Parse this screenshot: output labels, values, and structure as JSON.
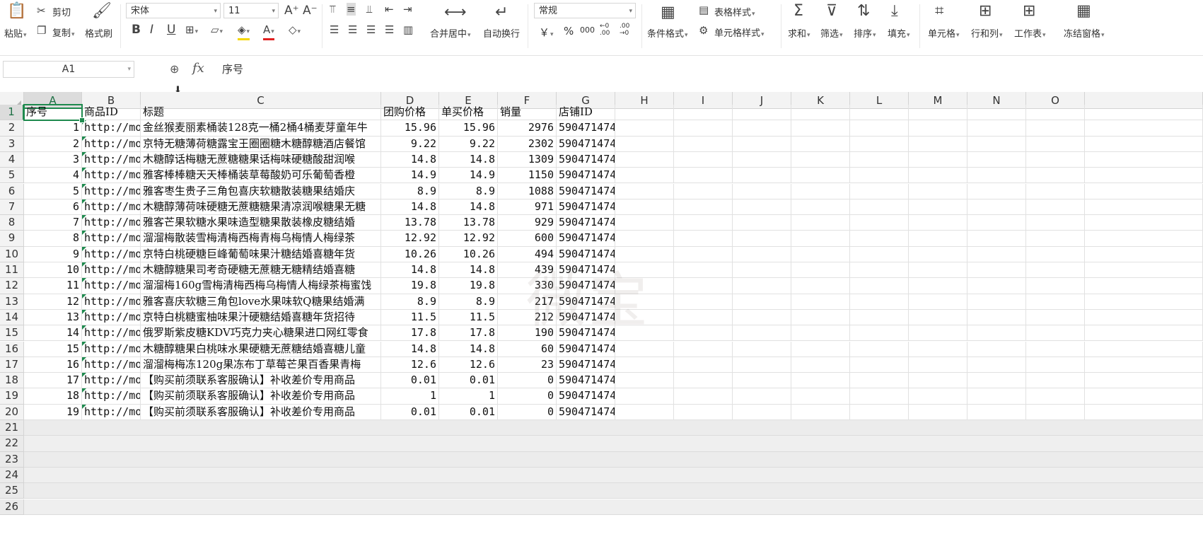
{
  "ribbon": {
    "paste": "粘贴",
    "cut": "剪切",
    "copy": "复制",
    "format_painter": "格式刷",
    "font_name": "宋体",
    "font_size": "11",
    "merge_center": "合并居中",
    "wrap_text": "自动换行",
    "number_format": "常规",
    "currency_symbol": "￥",
    "percent_symbol": "%",
    "thousands_symbol": "000",
    "inc_decimal": "←0 .00",
    "dec_decimal": ".00 →0",
    "conditional_format": "条件格式",
    "table_style": "表格样式",
    "cell_style": "单元格样式",
    "sum": "求和",
    "filter": "筛选",
    "sort": "排序",
    "fill": "填充",
    "cell": "单元格",
    "rows_cols": "行和列",
    "worksheet": "工作表",
    "freeze": "冻结窗格"
  },
  "formula_bar": {
    "name_box": "A1",
    "fx": "fx",
    "content": "序号"
  },
  "columns": [
    "A",
    "B",
    "C",
    "D",
    "E",
    "F",
    "G",
    "H",
    "I",
    "J",
    "K",
    "L",
    "M",
    "N",
    "O"
  ],
  "headers": {
    "A": "序号",
    "B": "商品ID",
    "C": "标题",
    "D": "团购价格",
    "E": "单买价格",
    "F": "销量",
    "G": "店铺ID"
  },
  "rows": [
    {
      "n": "1",
      "id": "http://mob",
      "title": "金丝猴麦丽素桶装128克一桶2桶4桶麦芽童年牛",
      "group": "15.96",
      "single": "15.96",
      "sales": "2976",
      "shop": "590471474"
    },
    {
      "n": "2",
      "id": "http://mob",
      "title": "京特无糖薄荷糖露宝王圈圈糖木糖醇糖酒店餐馆",
      "group": "9.22",
      "single": "9.22",
      "sales": "2302",
      "shop": "590471474"
    },
    {
      "n": "3",
      "id": "http://mob",
      "title": "木糖醇话梅糖无蔗糖糖果话梅味硬糖酸甜润喉",
      "group": "14.8",
      "single": "14.8",
      "sales": "1309",
      "shop": "590471474"
    },
    {
      "n": "4",
      "id": "http://mob",
      "title": "雅客棒棒糖天天棒桶装草莓酸奶可乐葡萄香橙",
      "group": "14.9",
      "single": "14.9",
      "sales": "1150",
      "shop": "590471474"
    },
    {
      "n": "5",
      "id": "http://mob",
      "title": "雅客枣生贵子三角包喜庆软糖散装糖果结婚庆",
      "group": "8.9",
      "single": "8.9",
      "sales": "1088",
      "shop": "590471474"
    },
    {
      "n": "6",
      "id": "http://mob",
      "title": "木糖醇薄荷味硬糖无蔗糖糖果清凉润喉糖果无糖",
      "group": "14.8",
      "single": "14.8",
      "sales": "971",
      "shop": "590471474"
    },
    {
      "n": "7",
      "id": "http://mob",
      "title": "雅客芒果软糖水果味造型糖果散装橡皮糖结婚",
      "group": "13.78",
      "single": "13.78",
      "sales": "929",
      "shop": "590471474"
    },
    {
      "n": "8",
      "id": "http://mob",
      "title": "溜溜梅散装雪梅清梅西梅青梅乌梅情人梅绿茶",
      "group": "12.92",
      "single": "12.92",
      "sales": "600",
      "shop": "590471474"
    },
    {
      "n": "9",
      "id": "http://mob",
      "title": "京特白桃硬糖巨峰葡萄味果汁糖结婚喜糖年货",
      "group": "10.26",
      "single": "10.26",
      "sales": "494",
      "shop": "590471474"
    },
    {
      "n": "10",
      "id": "http://mob",
      "title": "木糖醇糖果司考奇硬糖无蔗糖无糖精结婚喜糖",
      "group": "14.8",
      "single": "14.8",
      "sales": "439",
      "shop": "590471474"
    },
    {
      "n": "11",
      "id": "http://mob",
      "title": "溜溜梅160g雪梅清梅西梅乌梅情人梅绿茶梅蜜饯",
      "group": "19.8",
      "single": "19.8",
      "sales": "330",
      "shop": "590471474"
    },
    {
      "n": "12",
      "id": "http://mob",
      "title": "雅客喜庆软糖三角包love水果味软Q糖果结婚满",
      "group": "8.9",
      "single": "8.9",
      "sales": "217",
      "shop": "590471474"
    },
    {
      "n": "13",
      "id": "http://mob",
      "title": "京特白桃糖蜜柚味果汁硬糖结婚喜糖年货招待",
      "group": "11.5",
      "single": "11.5",
      "sales": "212",
      "shop": "590471474"
    },
    {
      "n": "14",
      "id": "http://mob",
      "title": "俄罗斯紫皮糖KDV巧克力夹心糖果进口网红零食",
      "group": "17.8",
      "single": "17.8",
      "sales": "190",
      "shop": "590471474"
    },
    {
      "n": "15",
      "id": "http://mob",
      "title": "木糖醇糖果白桃味水果硬糖无蔗糖结婚喜糖儿童",
      "group": "14.8",
      "single": "14.8",
      "sales": "60",
      "shop": "590471474"
    },
    {
      "n": "16",
      "id": "http://mob",
      "title": "溜溜梅梅冻120g果冻布丁草莓芒果百香果青梅",
      "group": "12.6",
      "single": "12.6",
      "sales": "23",
      "shop": "590471474"
    },
    {
      "n": "17",
      "id": "http://mob",
      "title": "【购买前须联系客服确认】补收差价专用商品",
      "group": "0.01",
      "single": "0.01",
      "sales": "0",
      "shop": "590471474"
    },
    {
      "n": "18",
      "id": "http://mob",
      "title": "【购买前须联系客服确认】补收差价专用商品",
      "group": "1",
      "single": "1",
      "sales": "0",
      "shop": "590471474"
    },
    {
      "n": "19",
      "id": "http://mob",
      "title": "【购买前须联系客服确认】补收差价专用商品",
      "group": "0.01",
      "single": "0.01",
      "sales": "0",
      "shop": "590471474"
    }
  ],
  "row_numbers": [
    "1",
    "2",
    "3",
    "4",
    "5",
    "6",
    "7",
    "8",
    "9",
    "10",
    "11",
    "12",
    "13",
    "14",
    "15",
    "16",
    "17",
    "18",
    "19",
    "20",
    "21",
    "22",
    "23",
    "24",
    "25",
    "26"
  ],
  "watermark": "微宝",
  "colors": {
    "selection": "#1e8a4e",
    "header_bg": "#f3f3f3",
    "grid_line": "#e1e1e1"
  }
}
